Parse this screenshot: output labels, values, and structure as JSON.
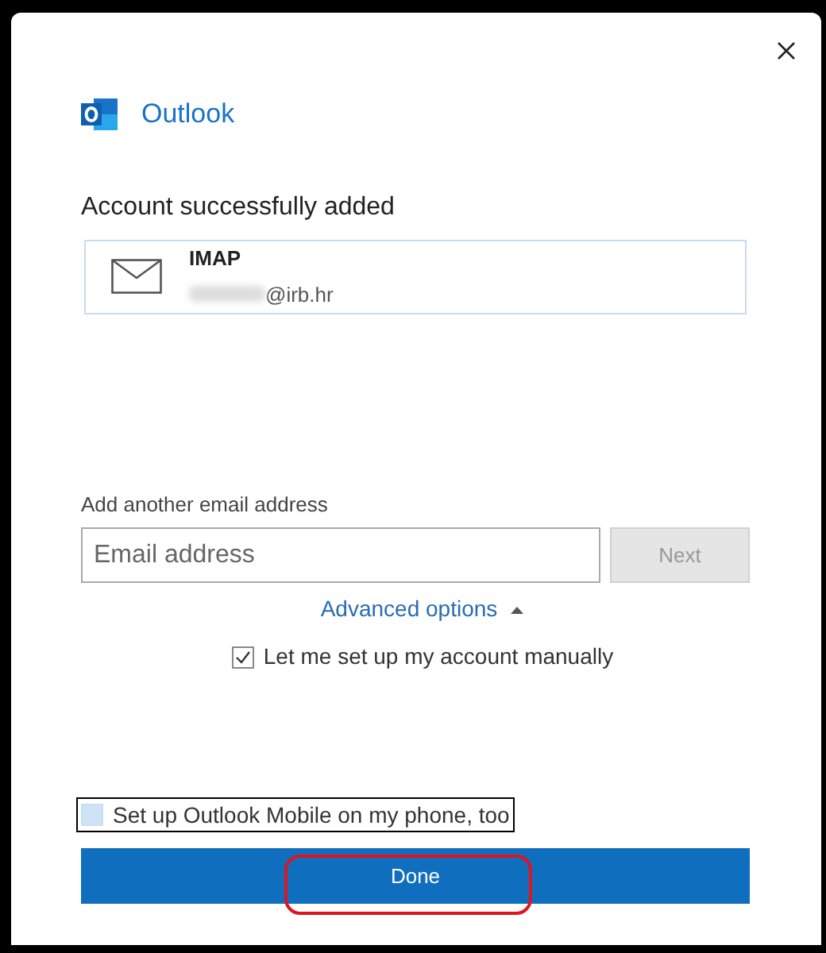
{
  "window": {
    "app_name": "Outlook"
  },
  "heading": "Account successfully added",
  "account": {
    "type": "IMAP",
    "email": "@irb.hr",
    "redacted": true
  },
  "add_label": "Add another email address",
  "email_field": {
    "placeholder": "Email address"
  },
  "next_button": {
    "label": "Next",
    "disabled": true
  },
  "advanced": {
    "label": "Advanced options",
    "expanded": true
  },
  "manual_setup": {
    "label": "Let me set up my account manually",
    "checked": true
  },
  "mobile_setup": {
    "label": "Set up Outlook Mobile on my phone, too",
    "checked": false,
    "focused": true
  },
  "done_button": {
    "label": "Done",
    "highlighted": true
  }
}
